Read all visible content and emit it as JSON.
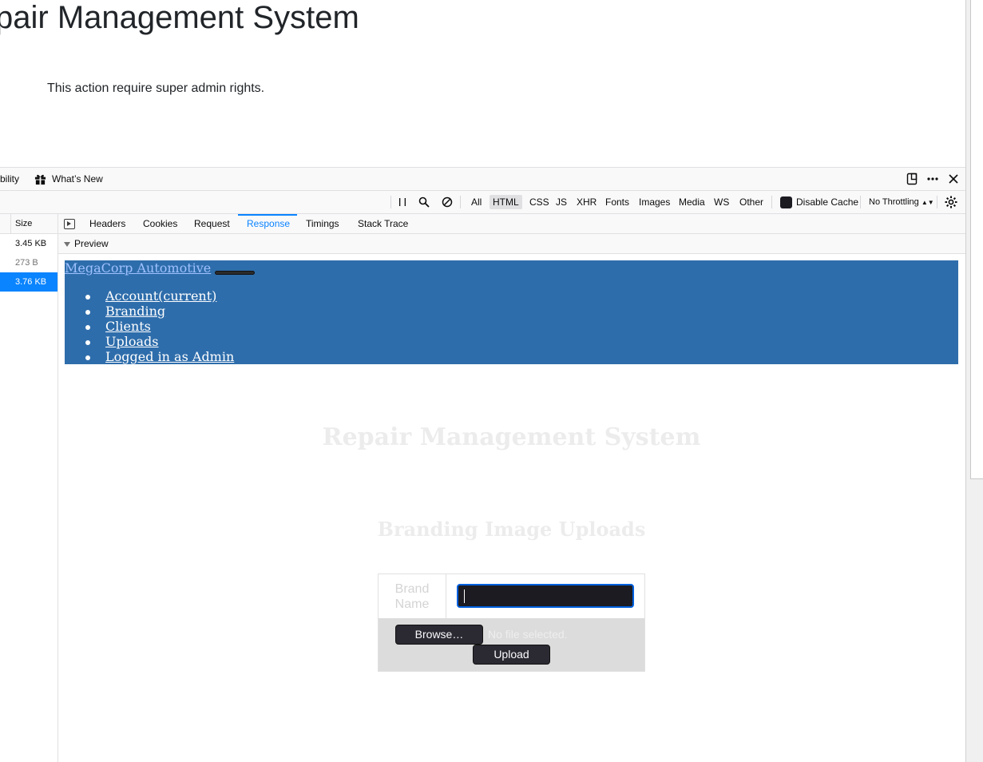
{
  "page": {
    "title": "pair Management System",
    "message": "This action require super admin rights."
  },
  "toolbox": {
    "tabs": [
      {
        "label": "bility"
      },
      {
        "label": "What’s New",
        "icon": "gift-icon"
      }
    ]
  },
  "network_toolbar": {
    "filters": [
      "All",
      "HTML",
      "CSS",
      "JS",
      "XHR",
      "Fonts",
      "Images",
      "Media",
      "WS",
      "Other"
    ],
    "selected_filter": "HTML",
    "disable_cache_label": "Disable Cache",
    "throttling_label": "No Throttling"
  },
  "request_list": {
    "column_header": "Size",
    "rows": [
      {
        "size": "3.45 KB"
      },
      {
        "size": "273 B"
      },
      {
        "size": "3.76 KB"
      }
    ]
  },
  "details": {
    "tabs": [
      "Headers",
      "Cookies",
      "Request",
      "Response",
      "Timings",
      "Stack Trace"
    ],
    "active_tab": "Response",
    "preview_label": "Preview"
  },
  "preview": {
    "brand": "MegaCorp Automotive",
    "nav_items": [
      "Account(current)",
      "Branding",
      "Clients",
      "Uploads",
      "Logged in as Admin"
    ],
    "title": "Repair Management System",
    "subtitle": "Branding Image Uploads",
    "form": {
      "brand_label": "Brand Name",
      "browse_label": "Browse…",
      "no_file_text": "No file selected.",
      "upload_label": "Upload"
    }
  },
  "colors": {
    "accent": "#0a84ff",
    "navbar": "#2e6dab"
  }
}
